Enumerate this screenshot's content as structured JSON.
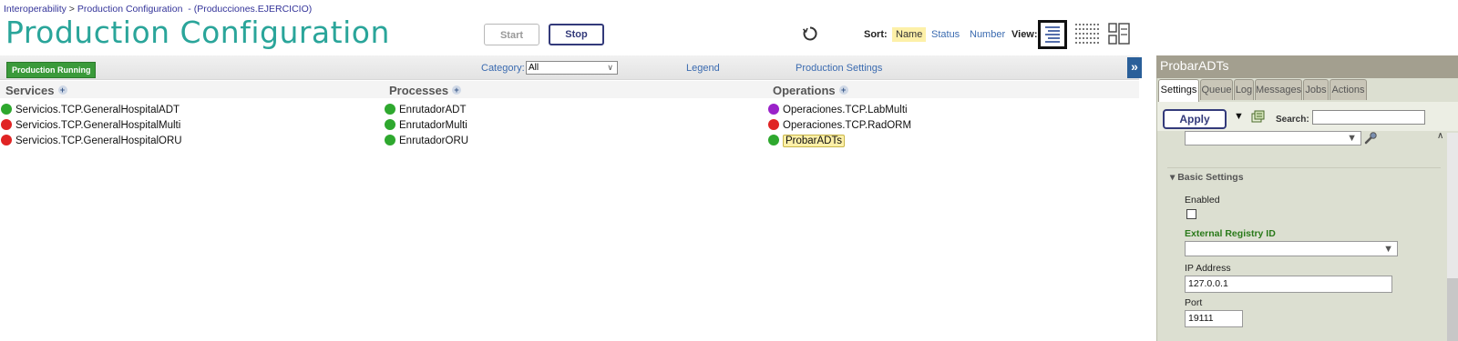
{
  "breadcrumb": {
    "root": "Interoperability",
    "separator": ">",
    "page": "Production Configuration",
    "context": "- (Producciones.EJERCICIO)"
  },
  "page_title": "Production Configuration",
  "controls": {
    "start_label": "Start",
    "stop_label": "Stop"
  },
  "sort": {
    "label": "Sort:",
    "options": [
      "Name",
      "Status",
      "Number"
    ],
    "selected": "Name"
  },
  "view": {
    "label": "View:",
    "options": [
      "list-view-icon",
      "grid-view-icon",
      "columns-view-icon"
    ],
    "selected": "list-view-icon"
  },
  "toolbar": {
    "status_badge": "Production Running",
    "category_label": "Category:",
    "category_value": "All",
    "legend_label": "Legend",
    "production_settings_label": "Production Settings",
    "collapse_label": "»"
  },
  "columns": {
    "services": {
      "header": "Services",
      "items": [
        {
          "label": "Servicios.TCP.GeneralHospitalADT",
          "status": "green"
        },
        {
          "label": "Servicios.TCP.GeneralHospitalMulti",
          "status": "red"
        },
        {
          "label": "Servicios.TCP.GeneralHospitalORU",
          "status": "red"
        }
      ]
    },
    "processes": {
      "header": "Processes",
      "items": [
        {
          "label": "EnrutadorADT",
          "status": "green"
        },
        {
          "label": "EnrutadorMulti",
          "status": "green"
        },
        {
          "label": "EnrutadorORU",
          "status": "green"
        }
      ]
    },
    "operations": {
      "header": "Operations",
      "items": [
        {
          "label": "Operaciones.TCP.LabMulti",
          "status": "purple"
        },
        {
          "label": "Operaciones.TCP.RadORM",
          "status": "red"
        },
        {
          "label": "ProbarADTs",
          "status": "green",
          "selected": true
        }
      ]
    }
  },
  "panel": {
    "title": "ProbarADTs",
    "tabs": [
      "Settings",
      "Queue",
      "Log",
      "Messages",
      "Jobs",
      "Actions"
    ],
    "active_tab": "Settings",
    "apply_label": "Apply",
    "search_label": "Search:",
    "search_value": "",
    "section_label": "Basic Settings",
    "fields": {
      "enabled_label": "Enabled",
      "enabled_checked": false,
      "external_registry_label": "External Registry ID",
      "external_registry_value": "",
      "ip_label": "IP Address",
      "ip_value": "127.0.0.1",
      "port_label": "Port",
      "port_value": "19111"
    }
  },
  "colors": {
    "title": "#2aa59a",
    "running_badge": "#3a9a3a",
    "status_green": "#2ea82e",
    "status_red": "#e02424",
    "status_purple": "#9a22c9",
    "panel_header": "#a39f8f",
    "panel_bg": "#dcdfd1"
  }
}
